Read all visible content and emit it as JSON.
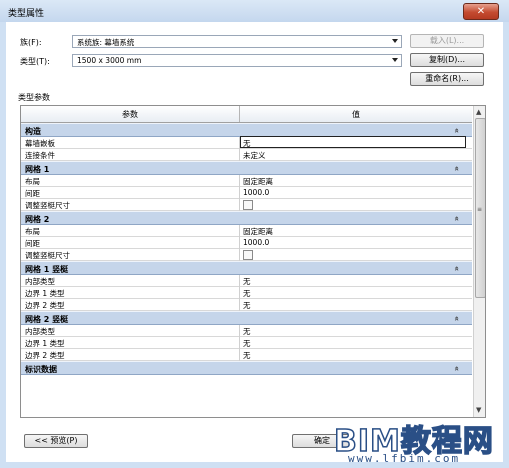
{
  "window": {
    "title": "类型属性",
    "close_label": "✕"
  },
  "family": {
    "label": "族(F):",
    "value": "系统族: 幕墙系统",
    "load_button": "载入(L)..."
  },
  "type": {
    "label": "类型(T):",
    "value": "1500 x 3000 mm",
    "duplicate_button": "复制(D)...",
    "rename_button": "重命名(R)..."
  },
  "section_title": "类型参数",
  "grid": {
    "col_param": "参数",
    "col_value": "值",
    "groups": [
      {
        "name": "构造",
        "rows": [
          {
            "name": "幕墙嵌板",
            "value": "无",
            "editing": true
          },
          {
            "name": "连接条件",
            "value": "未定义"
          }
        ]
      },
      {
        "name": "网格 1",
        "rows": [
          {
            "name": "布局",
            "value": "固定距离"
          },
          {
            "name": "间距",
            "value": "1000.0"
          },
          {
            "name": "调整竖梃尺寸",
            "value": "",
            "checkbox": true
          }
        ]
      },
      {
        "name": "网格 2",
        "rows": [
          {
            "name": "布局",
            "value": "固定距离"
          },
          {
            "name": "间距",
            "value": "1000.0"
          },
          {
            "name": "调整竖梃尺寸",
            "value": "",
            "checkbox": true
          }
        ]
      },
      {
        "name": "网格 1 竖梃",
        "rows": [
          {
            "name": "内部类型",
            "value": "无"
          },
          {
            "name": "边界 1 类型",
            "value": "无"
          },
          {
            "name": "边界 2 类型",
            "value": "无"
          }
        ]
      },
      {
        "name": "网格 2 竖梃",
        "rows": [
          {
            "name": "内部类型",
            "value": "无"
          },
          {
            "name": "边界 1 类型",
            "value": "无"
          },
          {
            "name": "边界 2 类型",
            "value": "无"
          }
        ]
      },
      {
        "name": "标识数据",
        "rows": []
      }
    ],
    "collapse_icon": "double-chevron-up-icon"
  },
  "footer": {
    "preview_button": "<< 预览(P)",
    "ok_button": "确定"
  },
  "watermark": {
    "text": "BIM教程网",
    "url": "www.lfbim.com"
  },
  "colors": {
    "group_header": "#c5d5ea",
    "window_frame": "#cfe0f3",
    "close_button": "#c44b30"
  }
}
